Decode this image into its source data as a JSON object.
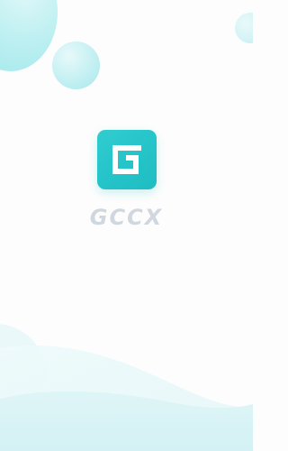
{
  "splash": {
    "brand_name": "GCCX",
    "logo_icon": "gccx-logo-icon"
  },
  "colors": {
    "accent": "#25c4c9",
    "wordmark": "#d1d7de",
    "bubble": "#b8eef0",
    "background": "#fdfdfd"
  }
}
